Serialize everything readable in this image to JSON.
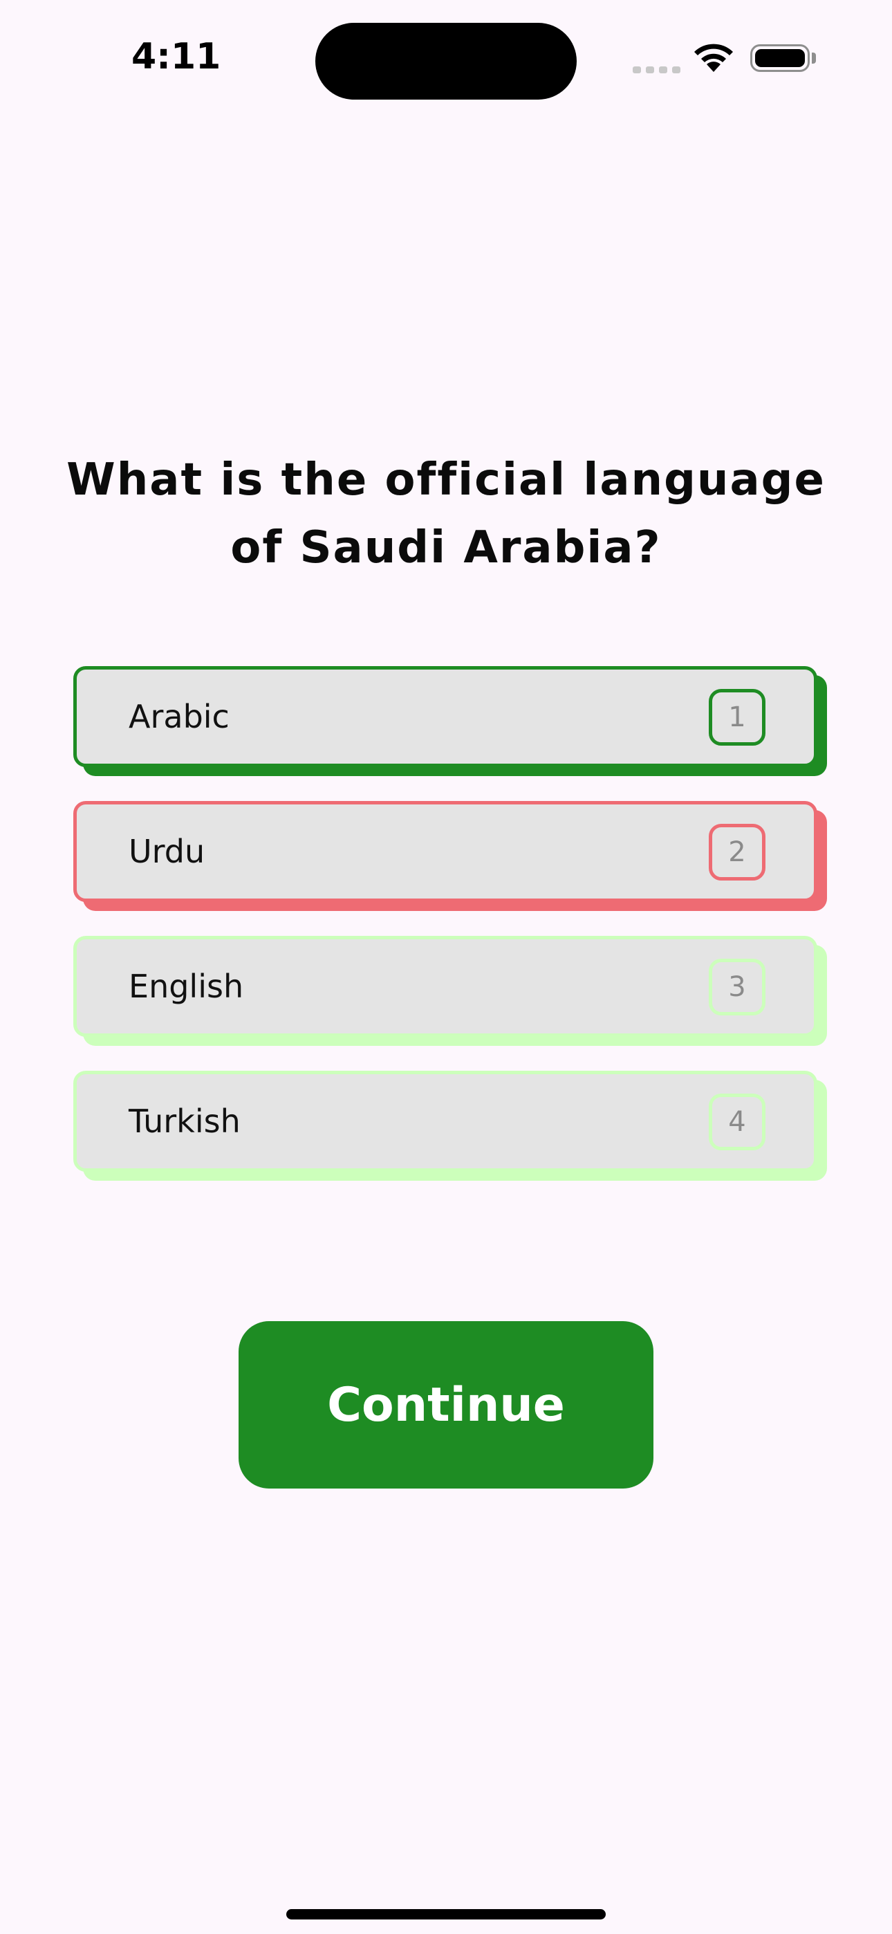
{
  "status_bar": {
    "time": "4:11",
    "icons": [
      "signal-icon",
      "wifi-icon",
      "battery-icon"
    ]
  },
  "quiz": {
    "question": "What is the official language of Saudi Arabia?",
    "answers": [
      {
        "label": "Arabic",
        "key": "1",
        "state": "correct",
        "color": "#1e8c23"
      },
      {
        "label": "Urdu",
        "key": "2",
        "state": "incorrect",
        "color": "#ee6b73"
      },
      {
        "label": "English",
        "key": "3",
        "state": "neutral",
        "color": "#ccffbb"
      },
      {
        "label": "Turkish",
        "key": "4",
        "state": "neutral",
        "color": "#ccffbb"
      }
    ],
    "continue_label": "Continue"
  },
  "colors": {
    "background": "#fdf7fd",
    "correct": "#1e8c23",
    "incorrect": "#ee6b73",
    "neutral": "#ccffbb",
    "button": "#1e8c23"
  }
}
